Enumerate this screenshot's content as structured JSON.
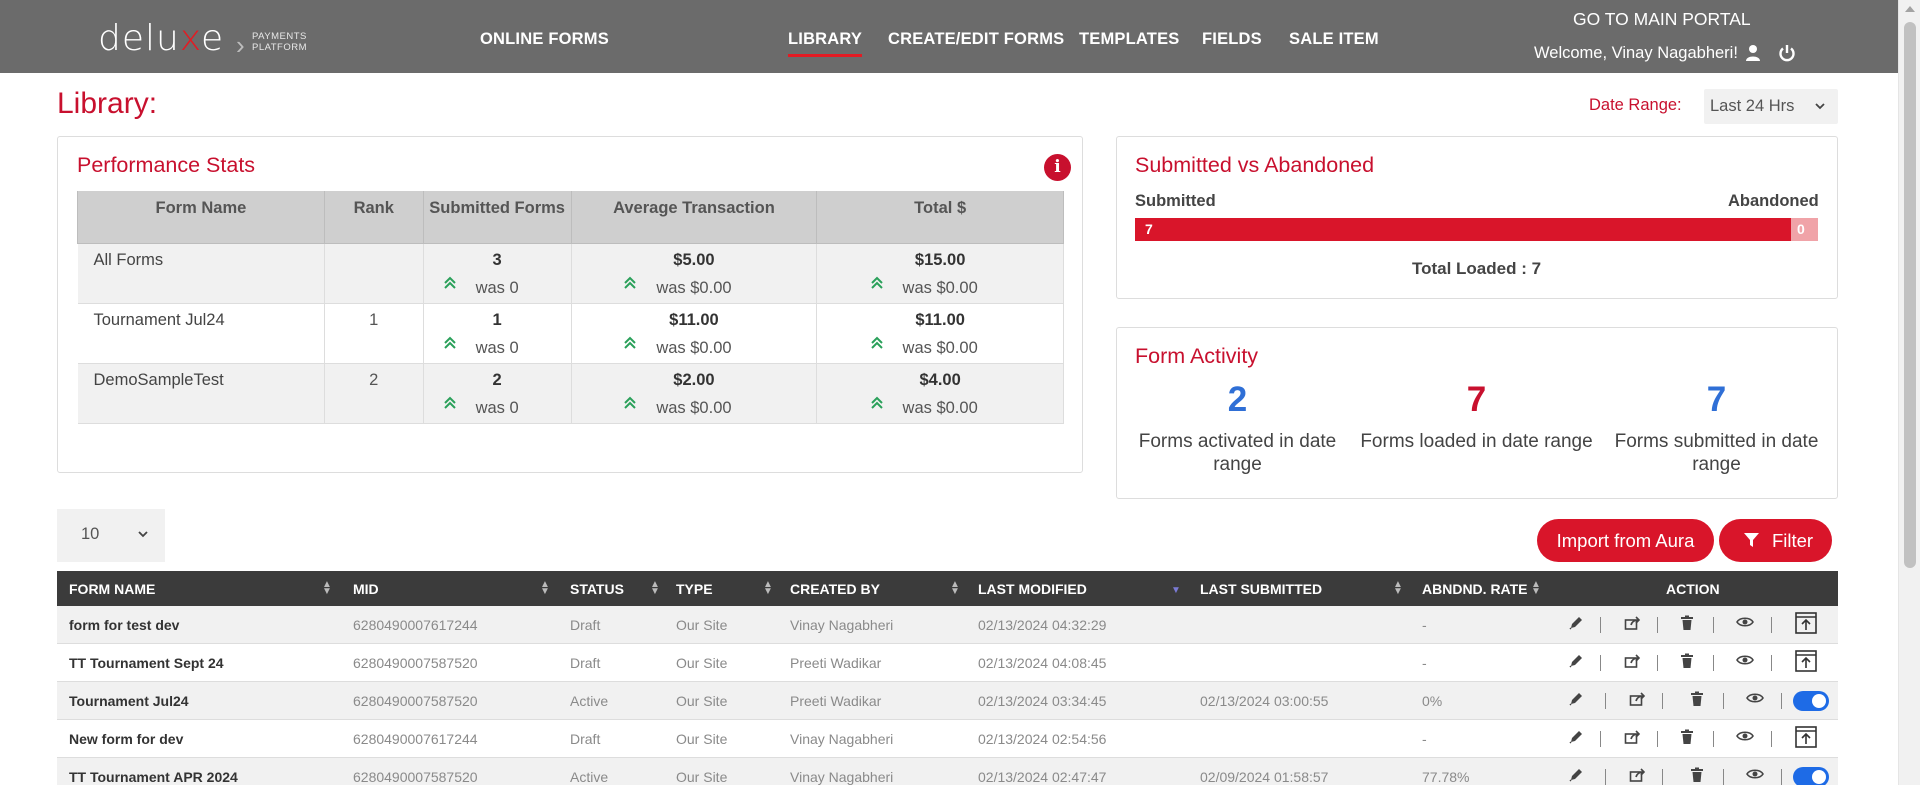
{
  "brand": {
    "logo_left": "delu",
    "logo_x": "x",
    "logo_right": "e",
    "sub_line1": "PAYMENTS",
    "sub_line2": "PLATFORM"
  },
  "nav": {
    "online_forms": "ONLINE FORMS",
    "library": "LIBRARY",
    "create_edit": "CREATE/EDIT FORMS",
    "templates": "TEMPLATES",
    "fields": "FIELDS",
    "sale_item": "SALE ITEM",
    "portal": "GO TO MAIN PORTAL",
    "welcome": "Welcome, Vinay Nagabheri!"
  },
  "page": {
    "title": "Library:",
    "date_range_label": "Date Range:",
    "date_range_value": "Last 24 Hrs"
  },
  "performance": {
    "title": "Performance Stats",
    "headers": [
      "Form Name",
      "Rank",
      "Submitted Forms",
      "Average Transaction",
      "Total $"
    ],
    "rows": [
      {
        "name": "All Forms",
        "rank": "",
        "submitted": "3",
        "submitted_was": "was 0",
        "avg": "$5.00",
        "avg_was": "was $0.00",
        "total": "$15.00",
        "total_was": "was $0.00"
      },
      {
        "name": "Tournament Jul24",
        "rank": "1",
        "submitted": "1",
        "submitted_was": "was 0",
        "avg": "$11.00",
        "avg_was": "was $0.00",
        "total": "$11.00",
        "total_was": "was $0.00"
      },
      {
        "name": "DemoSampleTest",
        "rank": "2",
        "submitted": "2",
        "submitted_was": "was 0",
        "avg": "$2.00",
        "avg_was": "was $0.00",
        "total": "$4.00",
        "total_was": "was $0.00"
      }
    ]
  },
  "sva": {
    "title": "Submitted vs Abandoned",
    "submitted_label": "Submitted",
    "abandoned_label": "Abandoned",
    "submitted_count": "7",
    "abandoned_count": "0",
    "submitted_fraction": 0.96,
    "total_loaded": "Total Loaded : 7"
  },
  "activity": {
    "title": "Form Activity",
    "items": [
      {
        "value": "2",
        "label": "Forms activated in date range",
        "color": "#2f6fd6"
      },
      {
        "value": "7",
        "label": "Forms loaded in date range",
        "color": "#c8102e"
      },
      {
        "value": "7",
        "label": "Forms submitted in date range",
        "color": "#2f6fd6"
      }
    ]
  },
  "list": {
    "page_size": "10",
    "import_label": "Import from Aura",
    "filter_label": "Filter",
    "columns": [
      "FORM NAME",
      "MID",
      "STATUS",
      "TYPE",
      "CREATED BY",
      "LAST MODIFIED",
      "LAST SUBMITTED",
      "ABNDND. RATE",
      "ACTION"
    ],
    "rows": [
      {
        "name": "form for test dev",
        "mid": "6280490007617244",
        "status": "Draft",
        "type": "Our Site",
        "created_by": "Vinay Nagabheri",
        "modified": "02/13/2024 04:32:29",
        "submitted": "",
        "rate": "-",
        "active": false
      },
      {
        "name": "TT Tournament Sept 24",
        "mid": "6280490007587520",
        "status": "Draft",
        "type": "Our Site",
        "created_by": "Preeti Wadikar",
        "modified": "02/13/2024 04:08:45",
        "submitted": "",
        "rate": "-",
        "active": false
      },
      {
        "name": "Tournament Jul24",
        "mid": "6280490007587520",
        "status": "Active",
        "type": "Our Site",
        "created_by": "Preeti Wadikar",
        "modified": "02/13/2024 03:34:45",
        "submitted": "02/13/2024 03:00:55",
        "rate": "0%",
        "active": true
      },
      {
        "name": "New form for dev",
        "mid": "6280490007617244",
        "status": "Draft",
        "type": "Our Site",
        "created_by": "Vinay Nagabheri",
        "modified": "02/13/2024 02:54:56",
        "submitted": "",
        "rate": "-",
        "active": false
      },
      {
        "name": "TT Tournament APR 2024",
        "mid": "6280490007587520",
        "status": "Active",
        "type": "Our Site",
        "created_by": "Vinay Nagabheri",
        "modified": "02/13/2024 02:47:47",
        "submitted": "02/09/2024 01:58:57",
        "rate": "77.78%",
        "active": true
      }
    ]
  }
}
